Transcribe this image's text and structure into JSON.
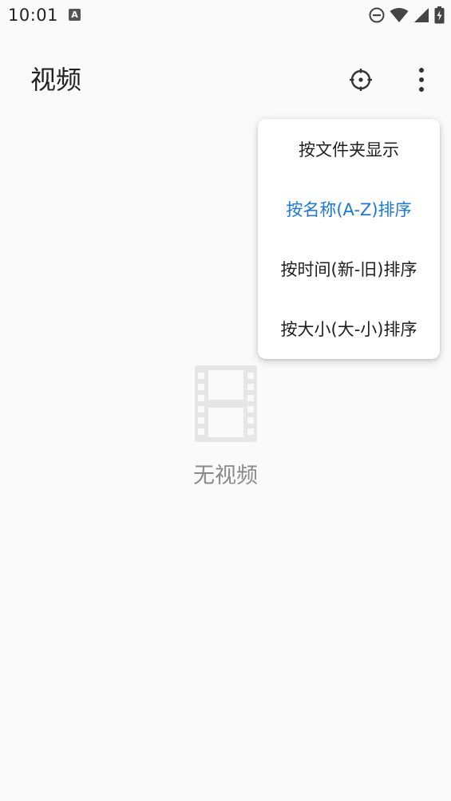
{
  "status_bar": {
    "time": "10:01",
    "notification_icon": "a-icon",
    "notification_letter": "A",
    "icons": [
      "do-not-disturb-icon",
      "wifi-icon",
      "signal-icon",
      "battery-charging-icon"
    ]
  },
  "app_bar": {
    "title": "视频",
    "actions": [
      "target-icon",
      "more-vert-icon"
    ]
  },
  "menu": {
    "items": [
      {
        "label": "按文件夹显示",
        "selected": false
      },
      {
        "label": "按名称(A-Z)排序",
        "selected": true
      },
      {
        "label": "按时间(新-旧)排序",
        "selected": false
      },
      {
        "label": "按大小(大-小)排序",
        "selected": false
      }
    ]
  },
  "empty_state": {
    "icon": "film-icon",
    "text": "无视频"
  },
  "colors": {
    "background": "#fafafa",
    "accent": "#1a7ad4",
    "text_primary": "#222222",
    "text_secondary": "#8a8a8a",
    "icon_placeholder": "#e6e6e6"
  }
}
